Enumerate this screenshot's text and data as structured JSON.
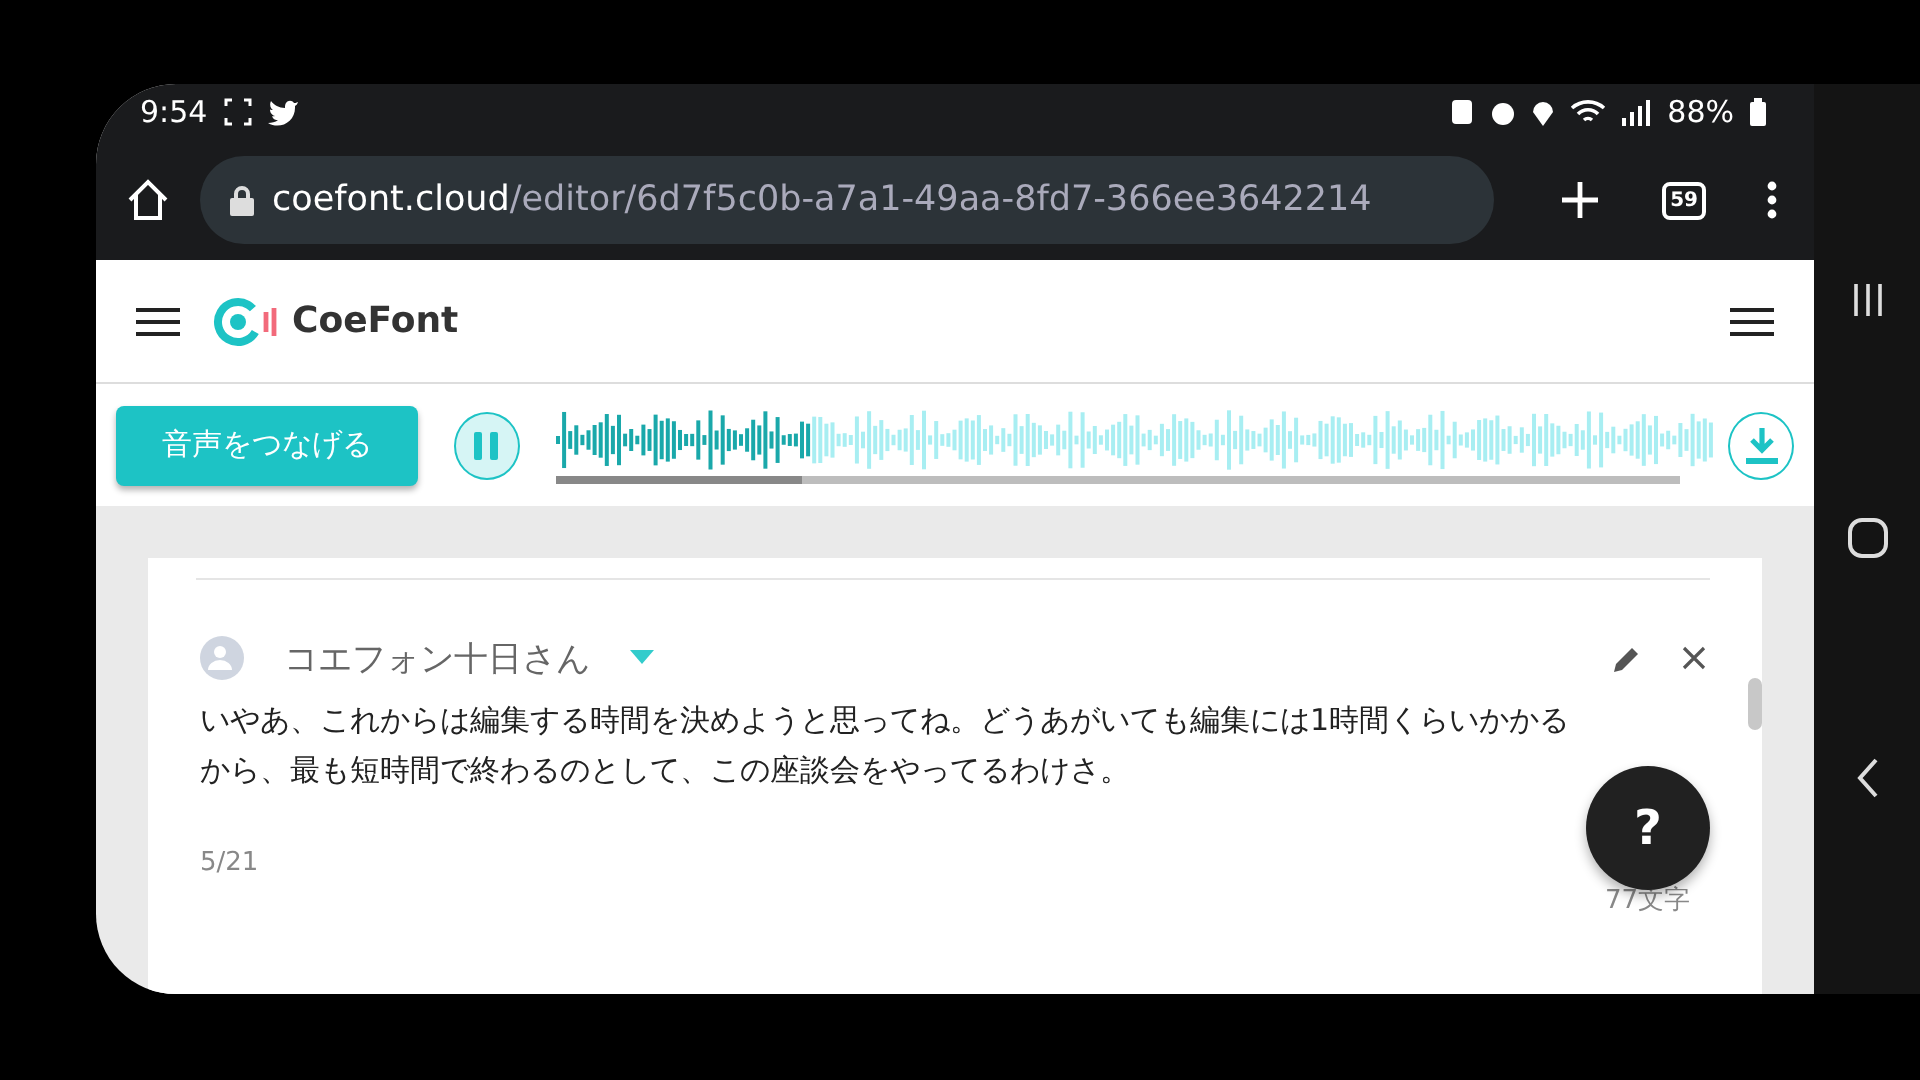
{
  "status_bar": {
    "time": "9:54",
    "battery": "88%"
  },
  "browser": {
    "url_host": "coefont.cloud",
    "url_path": "/editor/6d7f5c0b-a7a1-49aa-8fd7-366ee3642214",
    "tab_count": "59"
  },
  "app_header": {
    "logo_text": "CoeFont"
  },
  "toolbar": {
    "join_button": "音声をつなげる",
    "playing": true,
    "playback": {
      "level": 0.22
    }
  },
  "card": {
    "speaker": "コエフォン十日さん",
    "text": "いやあ、これからは編集する時間を決めようと思ってね。どうあがいても編集には1時間くらいかかるから、最も短時間で終わるのとして、この座談会をやってるわけさ。",
    "index": "5/21",
    "char_count": "77文字"
  },
  "help_button": "?"
}
